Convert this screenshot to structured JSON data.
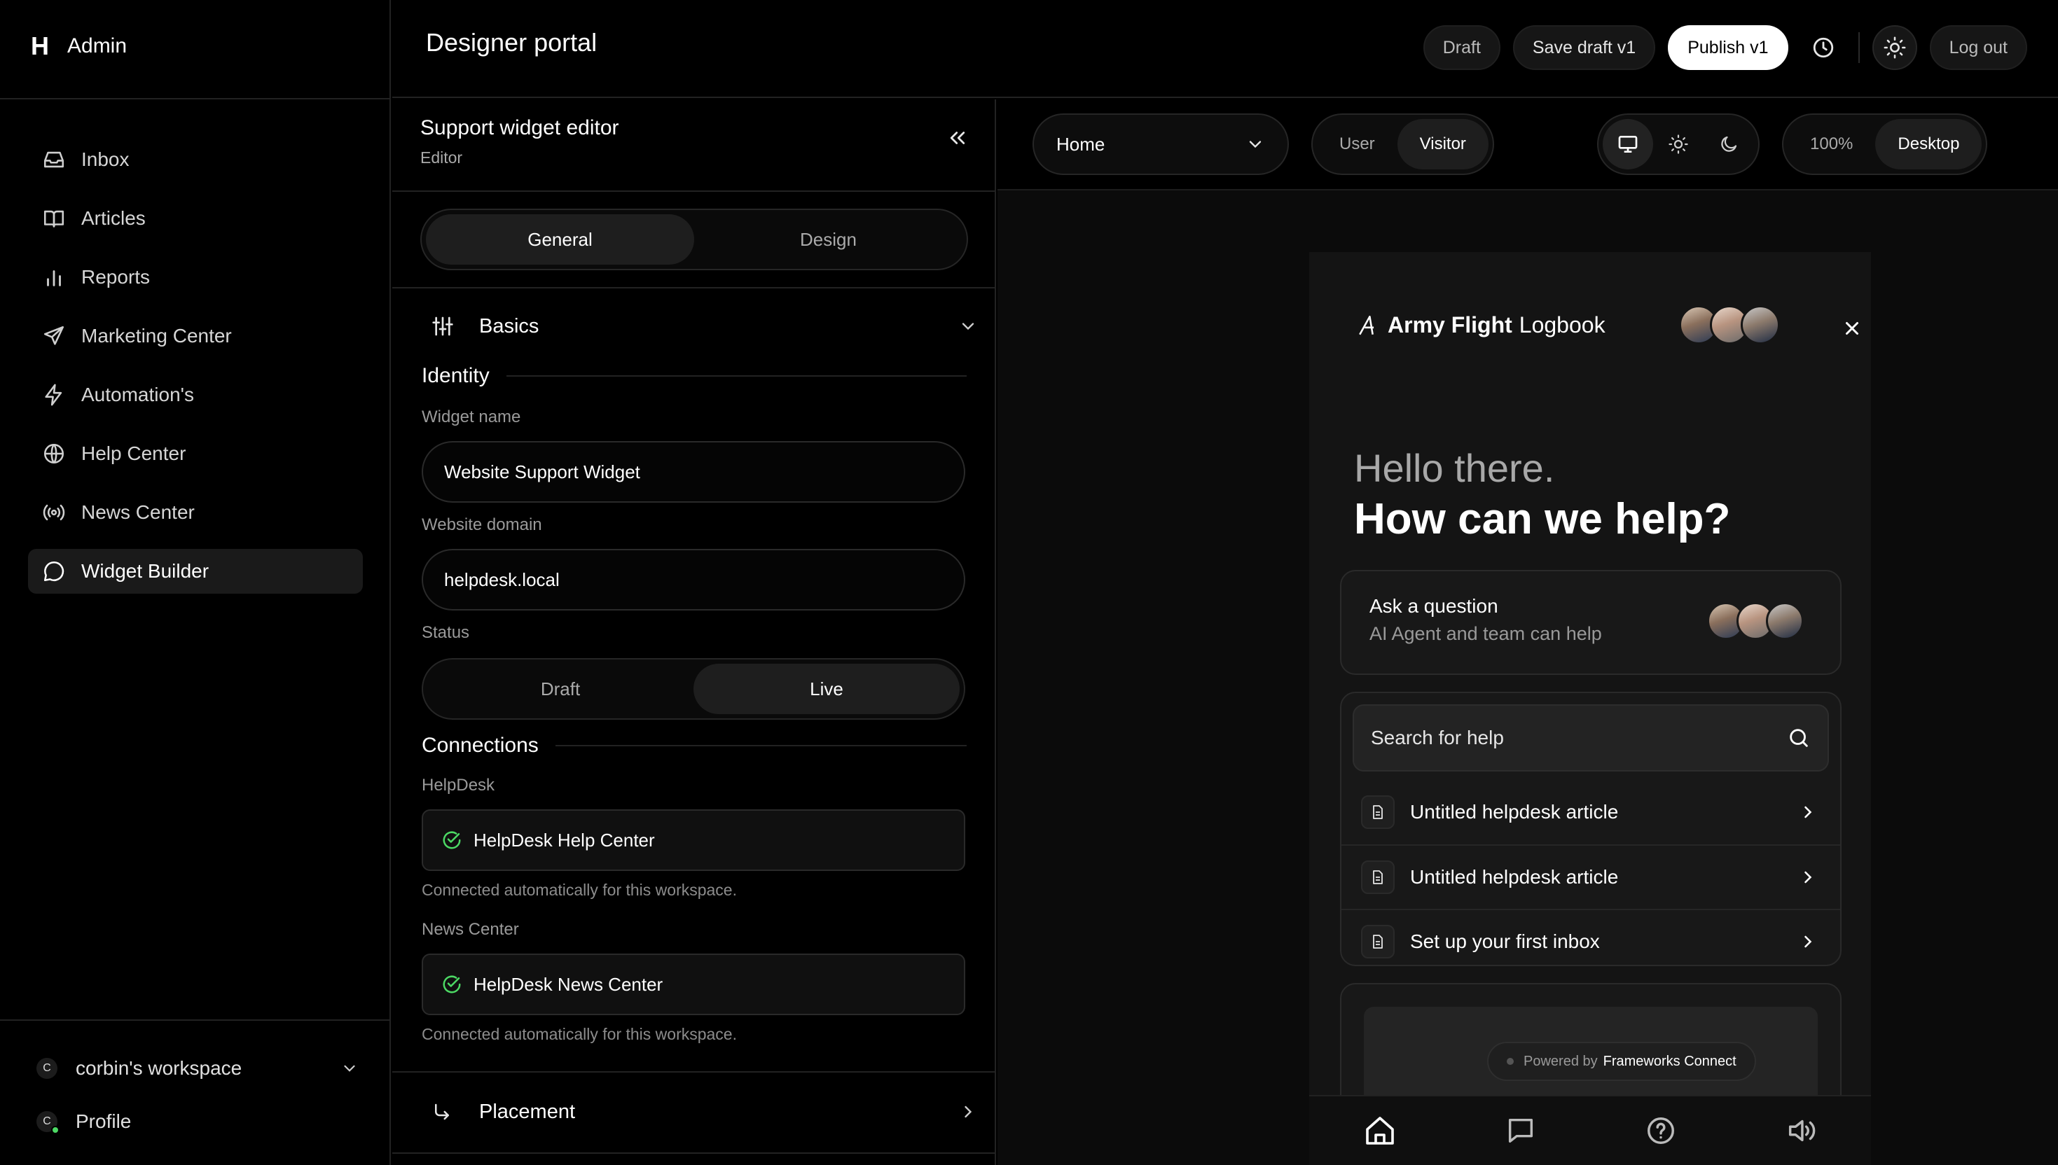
{
  "brand": {
    "mark": "H",
    "name": "Admin"
  },
  "sidebar": {
    "items": [
      {
        "label": "Inbox",
        "icon": "inbox-icon"
      },
      {
        "label": "Articles",
        "icon": "book-icon"
      },
      {
        "label": "Reports",
        "icon": "bar-chart-icon"
      },
      {
        "label": "Marketing Center",
        "icon": "send-icon"
      },
      {
        "label": "Automation's",
        "icon": "bolt-icon"
      },
      {
        "label": "Help Center",
        "icon": "globe-icon"
      },
      {
        "label": "News Center",
        "icon": "broadcast-icon"
      },
      {
        "label": "Widget Builder",
        "icon": "chat-icon",
        "active": true
      }
    ],
    "workspace": {
      "badge": "C",
      "label": "corbin's workspace"
    },
    "profile": {
      "badge": "C",
      "label": "Profile"
    }
  },
  "header": {
    "title": "Designer portal",
    "draft": "Draft",
    "save_draft": "Save draft v1",
    "publish": "Publish v1",
    "logout": "Log out"
  },
  "editor": {
    "title": "Support widget editor",
    "subtitle": "Editor",
    "tabs": [
      "General",
      "Design"
    ],
    "active_tab": "General",
    "basics_label": "Basics",
    "identity": {
      "title": "Identity",
      "widget_name_label": "Widget name",
      "widget_name_value": "Website Support Widget",
      "domain_label": "Website domain",
      "domain_value": "helpdesk.local",
      "status_label": "Status",
      "status_options": [
        "Draft",
        "Live"
      ],
      "status_selected": "Live"
    },
    "connections": {
      "title": "Connections",
      "helpdesk_label": "HelpDesk",
      "helpdesk_value": "HelpDesk Help Center",
      "helpdesk_hint": "Connected automatically for this workspace.",
      "news_label": "News Center",
      "news_value": "HelpDesk News Center",
      "news_hint": "Connected automatically for this workspace."
    },
    "placement_label": "Placement"
  },
  "preview": {
    "page_select": "Home",
    "audience": [
      "User",
      "Visitor"
    ],
    "audience_selected": "Visitor",
    "zoom": "100%",
    "device": "Desktop",
    "widget": {
      "logo_bold": "Army Flight",
      "logo_light": "Logbook",
      "greeting_line1": "Hello there.",
      "greeting_line2": "How can we help?",
      "ask_title": "Ask a question",
      "ask_subtitle": "AI Agent and team can help",
      "search_placeholder": "Search for help",
      "articles": [
        "Untitled helpdesk article",
        "Untitled helpdesk article",
        "Set up your first inbox"
      ],
      "powered_by": "Powered by",
      "powered_brand": "Frameworks Connect"
    }
  },
  "colors": {
    "background": "#000000",
    "panel": "#0b0b0b",
    "accent_white": "#ffffff",
    "success": "#4cd964"
  }
}
